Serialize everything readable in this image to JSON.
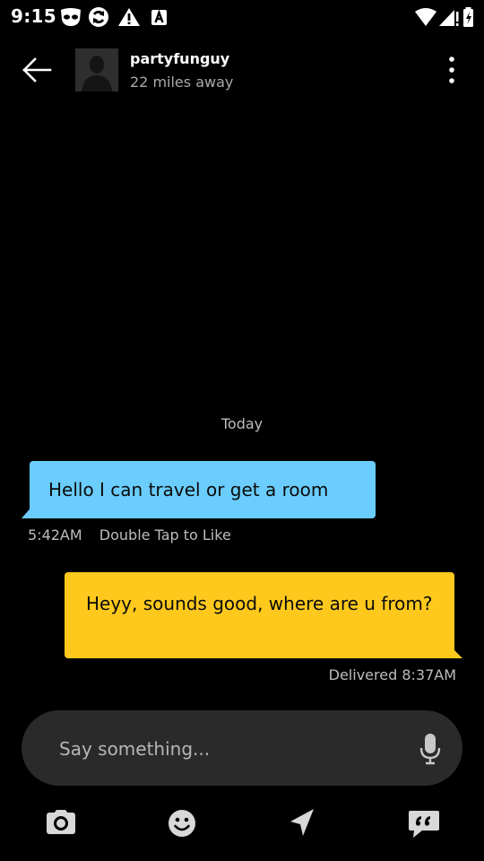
{
  "status_bar": {
    "time": "9:15"
  },
  "header": {
    "username": "partyfunguy",
    "distance": "22 miles away"
  },
  "conversation": {
    "day_separator": "Today",
    "incoming": {
      "text": "Hello I can travel or get a room",
      "time": "5:42AM",
      "like_hint": "Double Tap to Like",
      "bubble_color": "#6acdfd"
    },
    "outgoing": {
      "text": "Heyy, sounds good, where are u from?",
      "status": "Delivered 8:37AM",
      "bubble_color": "#fec91c"
    }
  },
  "composer": {
    "placeholder": "Say something..."
  },
  "toolbar": {
    "icons": [
      "camera-icon",
      "emoji-icon",
      "location-arrow-icon",
      "saved-phrases-icon"
    ]
  }
}
